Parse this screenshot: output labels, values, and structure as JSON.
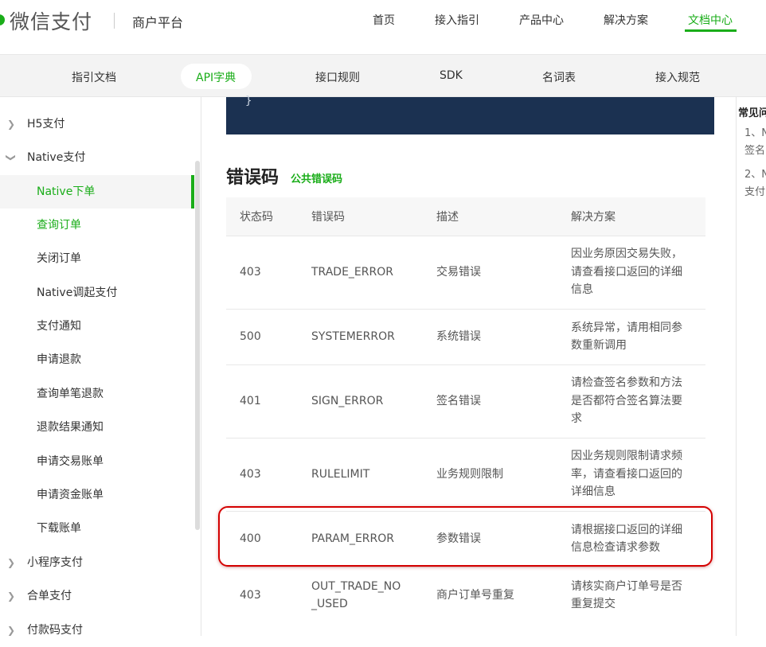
{
  "header": {
    "logo": "微信支付",
    "platform": "商户平台",
    "nav": [
      "首页",
      "接入指引",
      "产品中心",
      "解决方案",
      "文档中心"
    ],
    "active_nav": "文档中心"
  },
  "subnav": {
    "items": [
      "指引文档",
      "API字典",
      "接口规则",
      "SDK",
      "名词表",
      "接入规范"
    ],
    "active": "API字典"
  },
  "sidebar": {
    "items": [
      {
        "label": "H5支付",
        "type": "group",
        "expanded": false
      },
      {
        "label": "Native支付",
        "type": "group",
        "expanded": true
      },
      {
        "label": "Native下单",
        "type": "child",
        "selected": true
      },
      {
        "label": "查询订单",
        "type": "child",
        "hover": true
      },
      {
        "label": "关闭订单",
        "type": "child"
      },
      {
        "label": "Native调起支付",
        "type": "child"
      },
      {
        "label": "支付通知",
        "type": "child"
      },
      {
        "label": "申请退款",
        "type": "child"
      },
      {
        "label": "查询单笔退款",
        "type": "child"
      },
      {
        "label": "退款结果通知",
        "type": "child"
      },
      {
        "label": "申请交易账单",
        "type": "child"
      },
      {
        "label": "申请资金账单",
        "type": "child"
      },
      {
        "label": "下载账单",
        "type": "child"
      },
      {
        "label": "小程序支付",
        "type": "group",
        "expanded": false
      },
      {
        "label": "合单支付",
        "type": "group",
        "expanded": false
      },
      {
        "label": "付款码支付",
        "type": "group",
        "expanded": false
      }
    ]
  },
  "code": {
    "closing_brace": "}"
  },
  "errors": {
    "title": "错误码",
    "link": "公共错误码",
    "columns": [
      "状态码",
      "错误码",
      "描述",
      "解决方案"
    ],
    "rows": [
      {
        "status": "403",
        "code": "TRADE_ERROR",
        "desc": "交易错误",
        "solution": "因业务原因交易失败，请查看接口返回的详细信息"
      },
      {
        "status": "500",
        "code": "SYSTEMERROR",
        "desc": "系统错误",
        "solution": "系统异常，请用相同参数重新调用"
      },
      {
        "status": "401",
        "code": "SIGN_ERROR",
        "desc": "签名错误",
        "solution": "请检查签名参数和方法是否都符合签名算法要求"
      },
      {
        "status": "403",
        "code": "RULELIMIT",
        "desc": "业务规则限制",
        "solution": "因业务规则限制请求频率，请查看接口返回的详细信息"
      },
      {
        "status": "400",
        "code": "PARAM_ERROR",
        "desc": "参数错误",
        "solution": "请根据接口返回的详细信息检查请求参数"
      },
      {
        "status": "403",
        "code": "OUT_TRADE_NO_USED",
        "desc": "商户订单号重复",
        "solution": "请核实商户订单号是否重复提交"
      }
    ]
  },
  "right_panel": {
    "title": "常见问",
    "lines": [
      "1、N",
      "签名",
      "2、N",
      "支付"
    ]
  },
  "colors": {
    "accent": "#1aad19",
    "code_bg": "#1b3151",
    "highlight": "#d40000"
  }
}
